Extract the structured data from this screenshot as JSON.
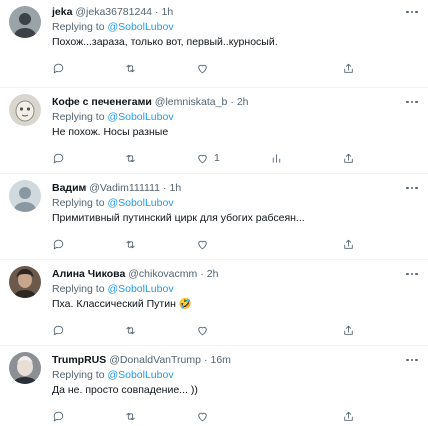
{
  "replying_prefix": "Replying to",
  "tweets": [
    {
      "name": "jeka",
      "handle": "@jeka36781244",
      "time": "1h",
      "reply_to": "@SobolLubov",
      "text": "Похож...зараза, только вот, первый..курносый.",
      "like_count": "",
      "avatar_colors": {
        "bg": "#9aa3a8",
        "fg": "#3c4247"
      }
    },
    {
      "name": "Кофе с печенегами",
      "handle": "@lemniskata_b",
      "time": "2h",
      "reply_to": "@SobolLubov",
      "text": "Не похож. Носы разные",
      "like_count": "1",
      "avatar_colors": {
        "bg": "#d9d6d0",
        "fg": "#8f8a83"
      }
    },
    {
      "name": "Вадим",
      "handle": "@Vadim111111",
      "time": "1h",
      "reply_to": "@SobolLubov",
      "text": "Примитивный путинский цирк для убогих рабсеян...",
      "like_count": "",
      "avatar_colors": {
        "bg": "#cfd9de",
        "fg": "#8a98a3"
      }
    },
    {
      "name": "Алина Чикова",
      "handle": "@chikovacmm",
      "time": "2h",
      "reply_to": "@SobolLubov",
      "text": "Пха. Классический Путин 🤣",
      "like_count": "",
      "avatar_colors": {
        "bg": "#6b5a4c",
        "fg": "#2e2620"
      }
    },
    {
      "name": "TrumpRUS",
      "handle": "@DonaldVanTrump",
      "time": "16m",
      "reply_to": "@SobolLubov",
      "text": "Да не. просто совпадение... ))",
      "like_count": "",
      "avatar_colors": {
        "bg": "#8c8f94",
        "fg": "#e7ded6"
      }
    }
  ]
}
